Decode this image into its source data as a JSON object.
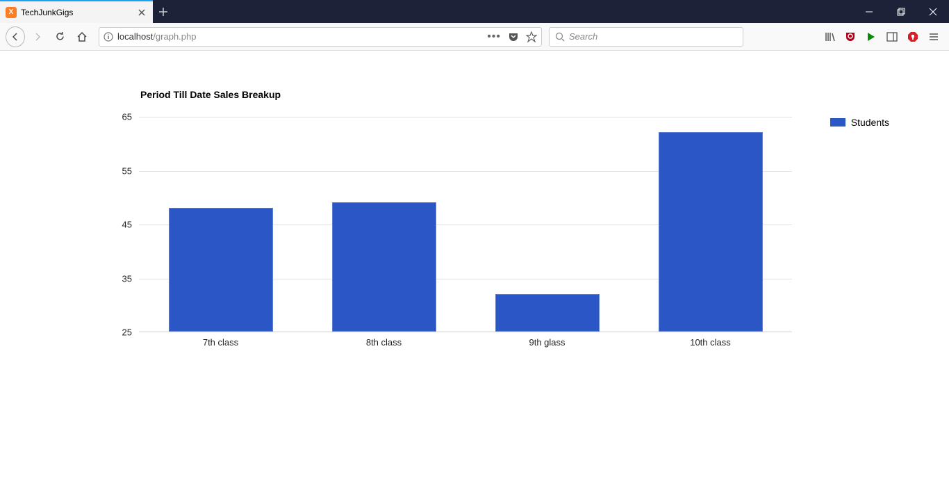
{
  "browser": {
    "tab_title": "TechJunkGigs",
    "url_host": "localhost",
    "url_path": "/graph.php",
    "search_placeholder": "Search"
  },
  "chart_data": {
    "type": "bar",
    "title": "Period Till Date Sales Breakup",
    "categories": [
      "7th class",
      "8th class",
      "9th glass",
      "10th class"
    ],
    "values": [
      48,
      49,
      32,
      62
    ],
    "series_name": "Students",
    "xlabel": "",
    "ylabel": "",
    "ylim": [
      25,
      65
    ],
    "yticks": [
      25,
      35,
      45,
      55,
      65
    ],
    "bar_color": "#2a56c6",
    "legend_position": "right"
  }
}
